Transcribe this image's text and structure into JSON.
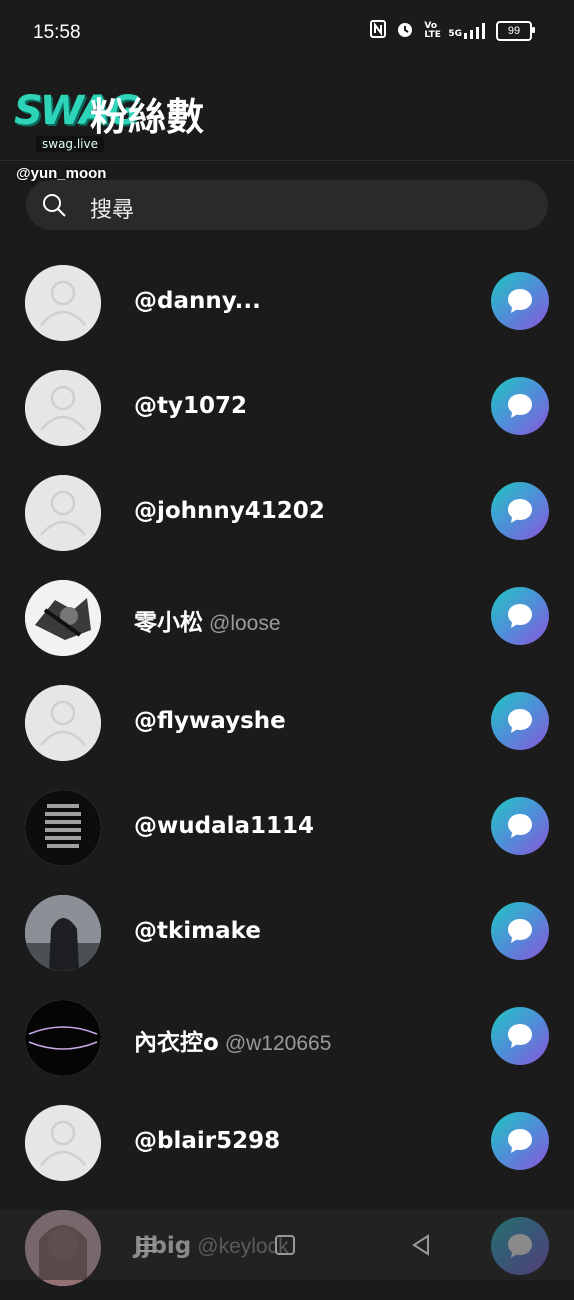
{
  "status_bar": {
    "time": "15:58",
    "battery": "99",
    "icons": [
      "nfc-icon",
      "alarm-icon",
      "volte-icon",
      "5g-signal-icon",
      "battery-icon"
    ],
    "volte_label": "Vo LTE",
    "network_label": "5G"
  },
  "header": {
    "title": "粉絲數",
    "logo_text": "SWAG",
    "logo_sub": "swag.live",
    "watermark_user": "@yun_moon"
  },
  "search": {
    "placeholder": "搜尋"
  },
  "followers": [
    {
      "name": "@danny...",
      "handle": "",
      "avatar": "default"
    },
    {
      "name": "@ty1072",
      "handle": "",
      "avatar": "default"
    },
    {
      "name": "@johnny41202",
      "handle": "",
      "avatar": "default"
    },
    {
      "name": "零小松",
      "handle": "@loose",
      "avatar": "photo-bw"
    },
    {
      "name": "@flywayshe",
      "handle": "",
      "avatar": "default"
    },
    {
      "name": "@wudala1114",
      "handle": "",
      "avatar": "photo-stripes"
    },
    {
      "name": "@tkimake",
      "handle": "",
      "avatar": "photo-hood"
    },
    {
      "name": "內衣控o",
      "handle": "@w120665",
      "avatar": "photo-dark"
    },
    {
      "name": "@blair5298",
      "handle": "",
      "avatar": "default"
    },
    {
      "name": "Jjbig",
      "handle": "@keylock",
      "avatar": "photo-pink"
    }
  ],
  "colors": {
    "background": "#1b1b1b",
    "accent_gradient_start": "#20c7c0",
    "accent_gradient_end": "#8a54d9",
    "logo": "#2dd4b8"
  }
}
